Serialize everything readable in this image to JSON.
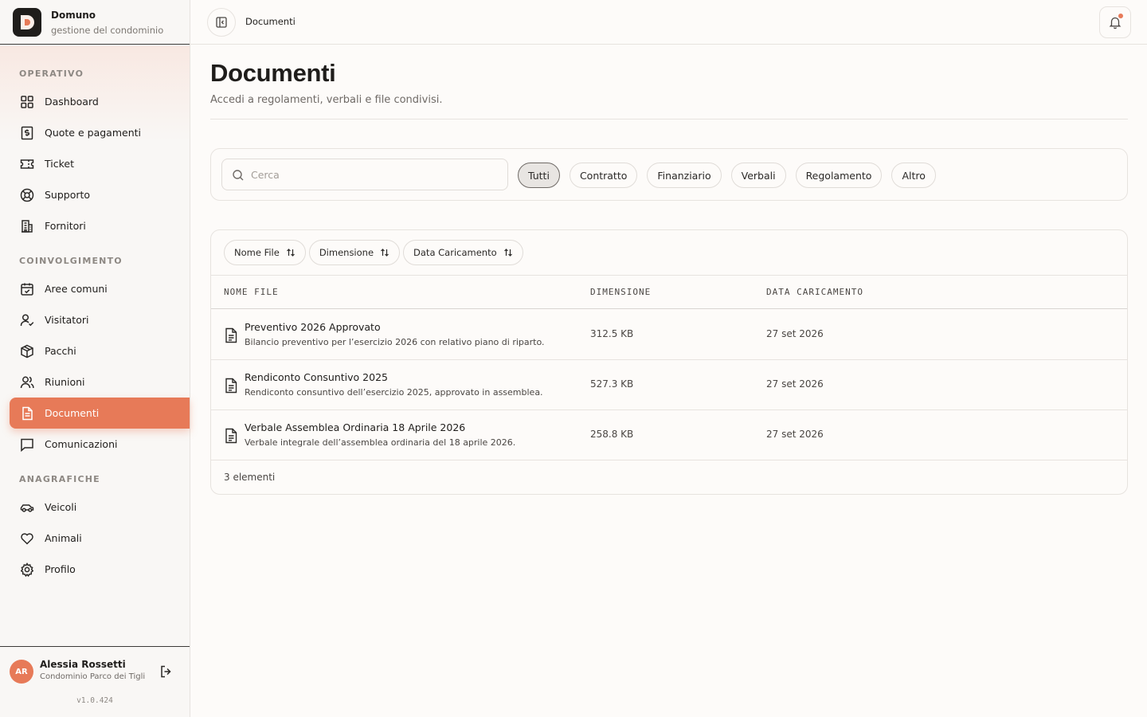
{
  "brand": {
    "name": "Domuno",
    "subtitle": "gestione del condominio"
  },
  "sidebar": {
    "sections": [
      {
        "label": "OPERATIVO",
        "items": [
          {
            "label": "Dashboard",
            "icon": "grid-icon"
          },
          {
            "label": "Quote e pagamenti",
            "icon": "receipt-icon"
          },
          {
            "label": "Ticket",
            "icon": "ticket-icon"
          },
          {
            "label": "Supporto",
            "icon": "lifebuoy-icon"
          },
          {
            "label": "Fornitori",
            "icon": "building-icon"
          }
        ]
      },
      {
        "label": "COINVOLGIMENTO",
        "items": [
          {
            "label": "Aree comuni",
            "icon": "calendar-icon"
          },
          {
            "label": "Visitatori",
            "icon": "user-check-icon"
          },
          {
            "label": "Pacchi",
            "icon": "package-icon"
          },
          {
            "label": "Riunioni",
            "icon": "users-icon"
          },
          {
            "label": "Documenti",
            "icon": "file-icon",
            "active": true
          },
          {
            "label": "Comunicazioni",
            "icon": "message-icon"
          }
        ]
      },
      {
        "label": "ANAGRAFICHE",
        "items": [
          {
            "label": "Veicoli",
            "icon": "car-icon"
          },
          {
            "label": "Animali",
            "icon": "heart-icon"
          },
          {
            "label": "Profilo",
            "icon": "gear-icon"
          }
        ]
      }
    ]
  },
  "user": {
    "initials": "AR",
    "name": "Alessia Rossetti",
    "org": "Condominio Parco dei Tigli",
    "version": "v1.0.424"
  },
  "topbar": {
    "title": "Documenti"
  },
  "page": {
    "title": "Documenti",
    "subtitle": "Accedi a regolamenti, verbali e file condivisi."
  },
  "filters": {
    "search_placeholder": "Cerca",
    "chips": [
      "Tutti",
      "Contratto",
      "Finanziario",
      "Verbali",
      "Regolamento",
      "Altro"
    ],
    "active": "Tutti"
  },
  "table": {
    "sort_buttons": [
      "Nome File",
      "Dimensione",
      "Data Caricamento"
    ],
    "headers": [
      "NOME FILE",
      "DIMENSIONE",
      "DATA CARICAMENTO"
    ],
    "rows": [
      {
        "name": "Preventivo 2026 Approvato",
        "description": "Bilancio preventivo per l’esercizio 2026 con relativo piano di riparto.",
        "size": "312.5 KB",
        "date": "27 set 2026"
      },
      {
        "name": "Rendiconto Consuntivo 2025",
        "description": "Rendiconto consuntivo dell’esercizio 2025, approvato in assemblea.",
        "size": "527.3 KB",
        "date": "27 set 2026"
      },
      {
        "name": "Verbale Assemblea Ordinaria 18 Aprile 2026",
        "description": "Verbale integrale dell’assemblea ordinaria del 18 aprile 2026.",
        "size": "258.8 KB",
        "date": "27 set 2026"
      }
    ],
    "count": "3 elementi"
  },
  "colors": {
    "accent": "#e77a58",
    "text": "#1f1d1b",
    "muted": "#6f6a66"
  }
}
